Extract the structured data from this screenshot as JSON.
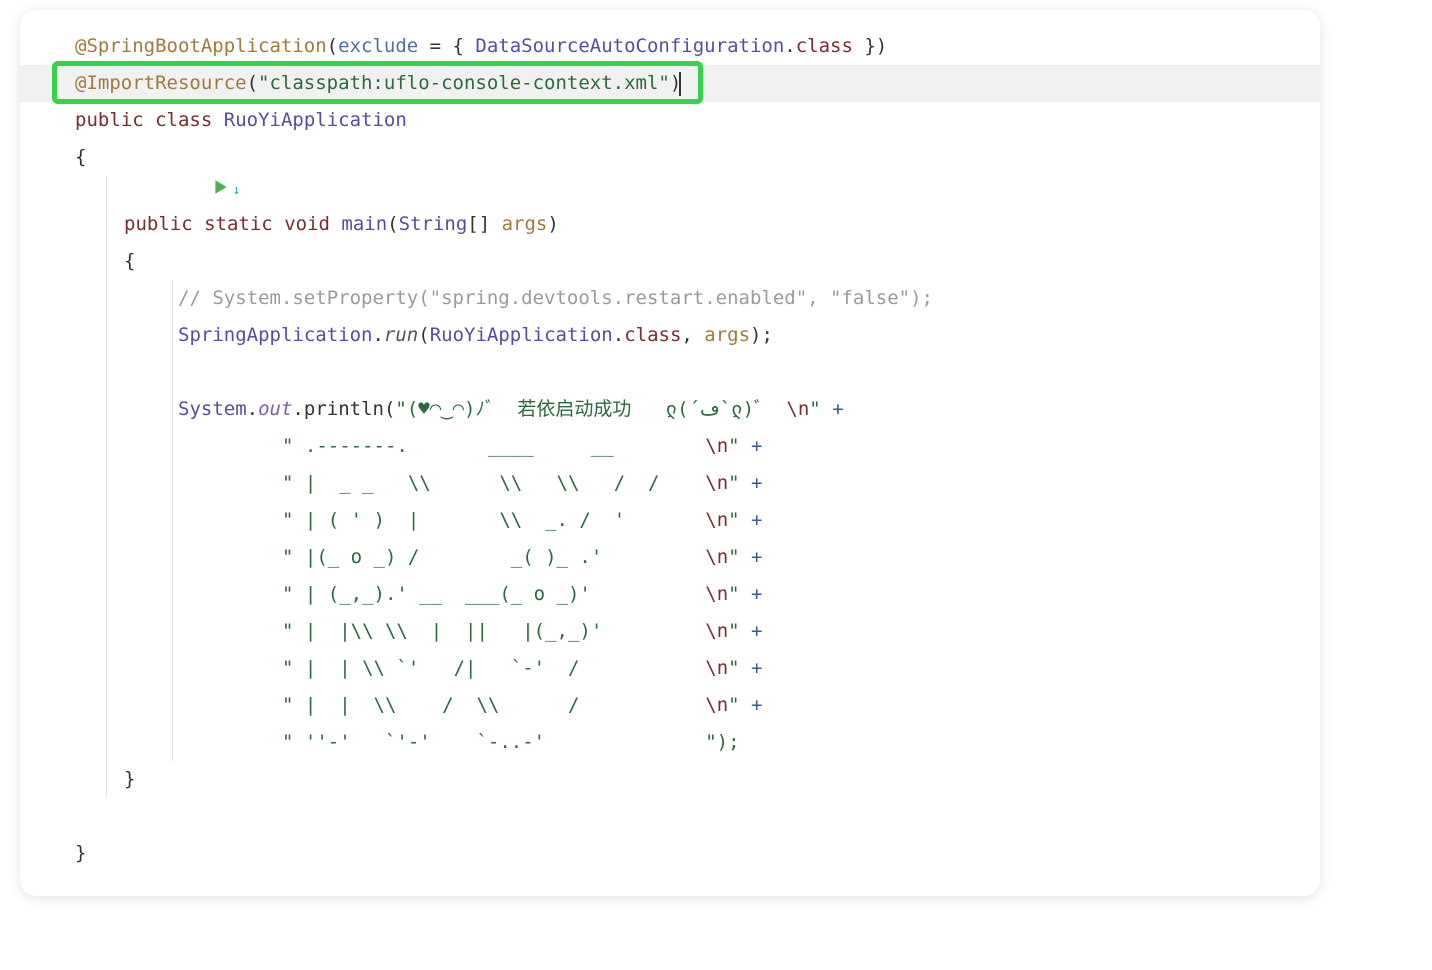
{
  "code": {
    "line1": {
      "annotation": "@SpringBootApplication",
      "paren_open": "(",
      "param": "exclude",
      "eq": " = { ",
      "class_ref": "DataSourceAutoConfiguration",
      "dot_class": ".",
      "class_kw": "class",
      "close": " })"
    },
    "line2": {
      "annotation": "@ImportResource",
      "paren_open": "(",
      "string": "\"classpath:uflo-console-context.xml\"",
      "close": ")"
    },
    "line3": {
      "kw_public": "public",
      "kw_class": "class",
      "name": "RuoYiApplication"
    },
    "brace_open": "{",
    "line5": {
      "kw_public": "public",
      "kw_static": "static",
      "kw_void": "void",
      "name": "main",
      "paren_open": "(",
      "type": "String",
      "brackets": "[] ",
      "arg": "args",
      "close": ")"
    },
    "inner_brace_open": "{",
    "comment": "// System.setProperty(\"spring.devtools.restart.enabled\", \"false\");",
    "line7": {
      "cls": "SpringApplication",
      "dot1": ".",
      "run": "run",
      "paren_open": "(",
      "arg_cls": "RuoYiApplication",
      "dot2": ".",
      "class_kw": "class",
      "comma": ", ",
      "arg": "args",
      "close": ");"
    },
    "print": {
      "sys": "System",
      "dot1": ".",
      "out": "out",
      "dot2": ".",
      "println": "println",
      "paren_open": "(",
      "s0a": "\"(♥◠‿◠)ﾉﾞ  若依启动成功   ლ(´ڡ`ლ)ﾞ  ",
      "esc": "\\n",
      "s0b": "\"",
      "plus": " +",
      "rows": [
        {
          "pre": "\" .-------.       ____     __        ",
          "esc": "\\n",
          "post": "\"",
          "plus": " +"
        },
        {
          "pre": "\" |  _ _   \\\\      \\\\   \\\\   /  /    ",
          "esc": "\\n",
          "post": "\"",
          "plus": " +"
        },
        {
          "pre": "\" | ( ' )  |       \\\\  _. /  '       ",
          "esc": "\\n",
          "post": "\"",
          "plus": " +"
        },
        {
          "pre": "\" |(_ o _) /        _( )_ .'         ",
          "esc": "\\n",
          "post": "\"",
          "plus": " +"
        },
        {
          "pre": "\" | (_,_).' __  ___(_ o _)'          ",
          "esc": "\\n",
          "post": "\"",
          "plus": " +"
        },
        {
          "pre": "\" |  |\\\\ \\\\  |  ||   |(_,_)'         ",
          "esc": "\\n",
          "post": "\"",
          "plus": " +"
        },
        {
          "pre": "\" |  | \\\\ `'   /|   `-'  /           ",
          "esc": "\\n",
          "post": "\"",
          "plus": " +"
        },
        {
          "pre": "\" |  |  \\\\    /  \\\\      /           ",
          "esc": "\\n",
          "post": "\"",
          "plus": " +"
        },
        {
          "pre": "\" ''-'   `'-'    `-..-'              \");",
          "esc": "",
          "post": "",
          "plus": ""
        }
      ]
    },
    "inner_brace_close": "}",
    "brace_close": "}"
  },
  "icons": {
    "run": "run-icon",
    "down": "download-icon"
  }
}
